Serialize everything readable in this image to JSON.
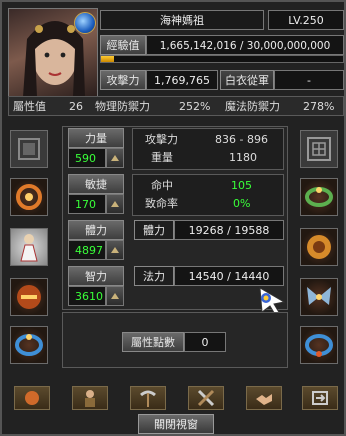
{
  "character": {
    "name": "海神媽祖",
    "level": "LV.250",
    "exp_label": "經驗值",
    "exp_value": "1,665,142,016 / 30,000,000,000",
    "exp_progress": 0.0555,
    "attack_label": "攻擊力",
    "attack_value": "1,769,765",
    "class_name": "白衣從軍",
    "class_value": "-"
  },
  "attributes_bar": {
    "attr_label": "屬性值",
    "attr_value": "26",
    "phys_def_label": "物理防禦力",
    "phys_def_value": "252%",
    "magic_def_label": "魔法防禦力",
    "magic_def_value": "278%"
  },
  "stats": {
    "str_label": "力量",
    "str_value": "590",
    "agi_label": "敏捷",
    "agi_value": "170",
    "vit_label": "體力",
    "vit_value": "4897",
    "int_label": "智力",
    "int_value": "3610",
    "attack_label": "攻擊力",
    "attack_range": "836 - 896",
    "weight_label": "重量",
    "weight_value": "1180",
    "hit_label": "命中",
    "hit_value": "105",
    "crit_label": "致命率",
    "crit_value": "0%",
    "hp_label": "體力",
    "hp_value": "19268 / 19588",
    "mp_label": "法力",
    "mp_value": "14540 / 14440",
    "points_label": "屬性點數",
    "points_value": "0"
  },
  "footer": {
    "close_label": "關閉視窗"
  },
  "colors": {
    "accent_green": "#39ff39",
    "exp_bar": "#ffb000"
  },
  "icons": [
    "portrait-avatar",
    "blue-orb-icon",
    "scroll-slot-icon",
    "rune-slot-icon",
    "ring-slot-icon",
    "bracelet-slot-icon",
    "figure-slot-icon",
    "dragon-slot-icon",
    "amulet-slot-icon",
    "wings-slot-icon",
    "chain-slot-icon",
    "orb-button-icon",
    "monk-button-icon",
    "pickaxe-button-icon",
    "tools-button-icon",
    "handshake-button-icon",
    "exchange-button-icon"
  ]
}
